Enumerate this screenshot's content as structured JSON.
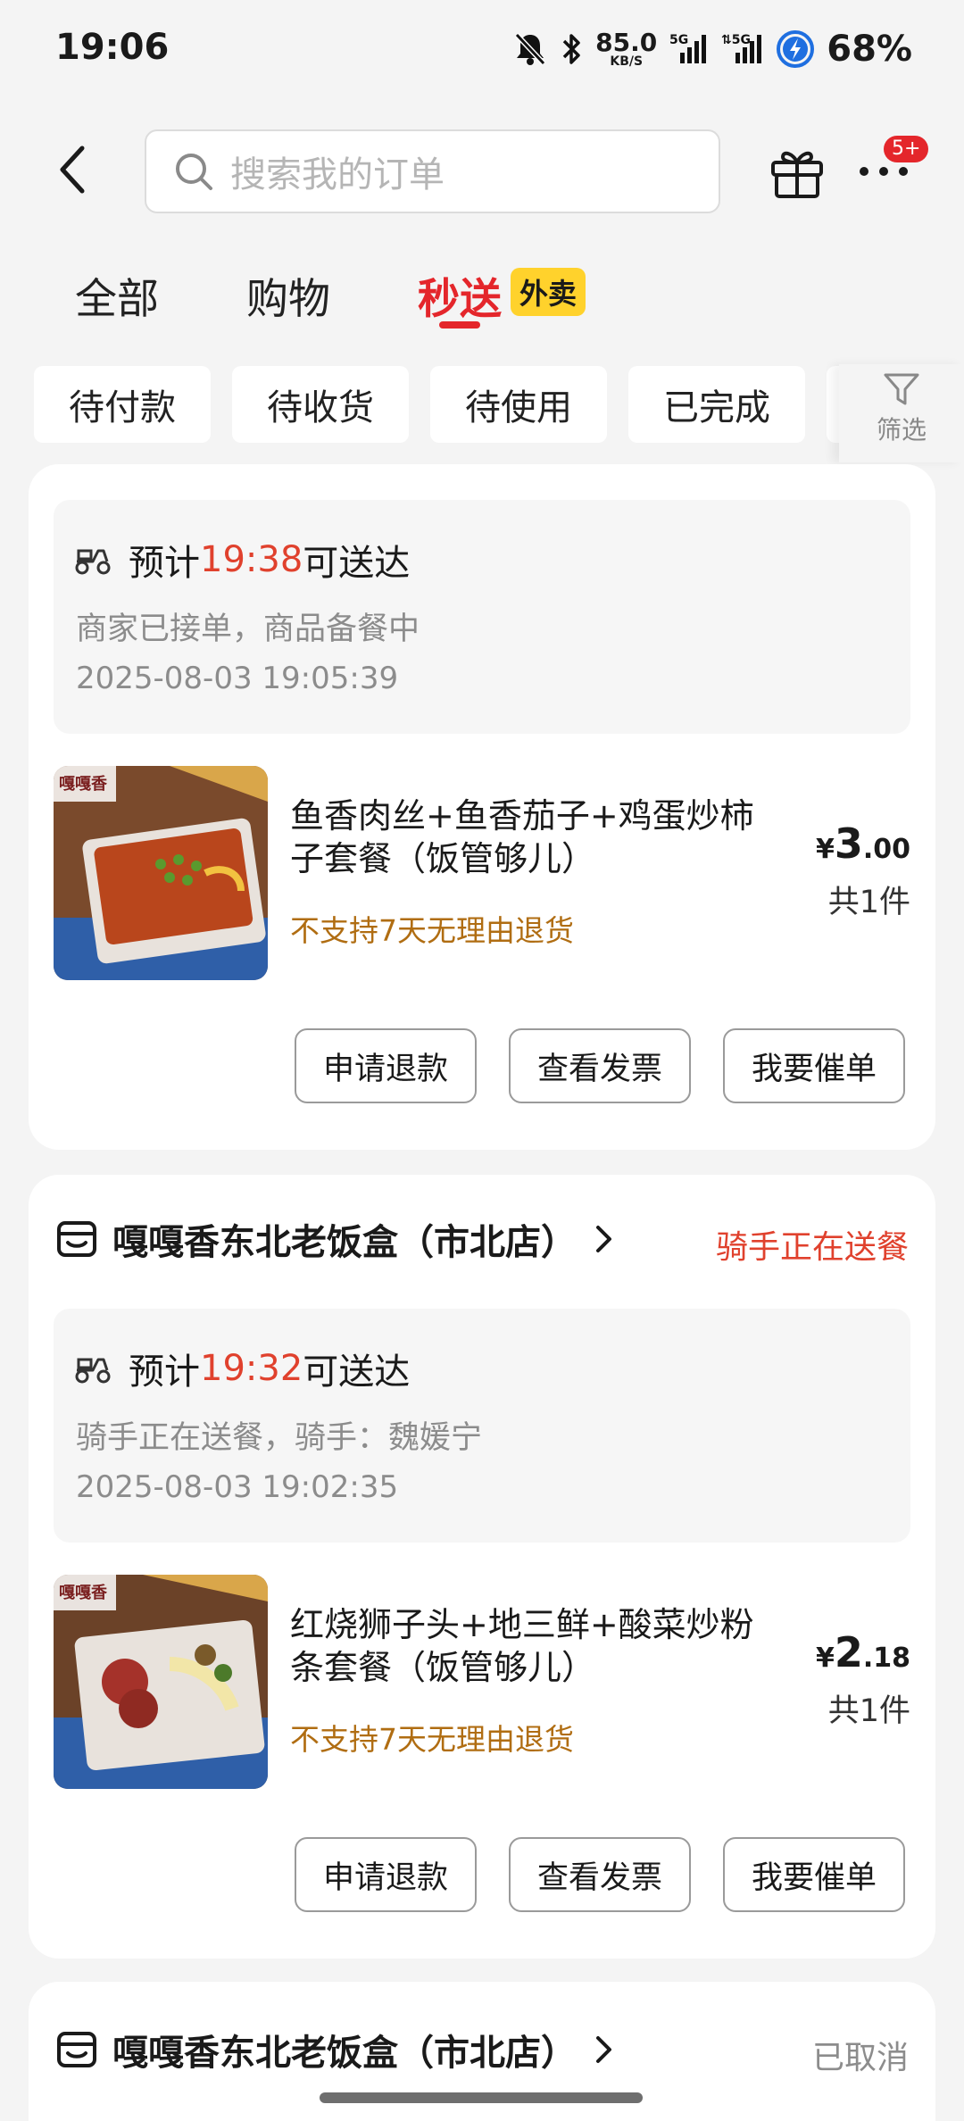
{
  "status": {
    "time": "19:06",
    "net_speed": "85.0",
    "net_unit": "KB/S",
    "sig1": "5G",
    "sig2": "5G",
    "battery": "68%"
  },
  "header": {
    "search_placeholder": "搜索我的订单",
    "badge": "5+"
  },
  "tabs": [
    {
      "label": "全部"
    },
    {
      "label": "购物"
    },
    {
      "label": "秒送"
    }
  ],
  "tab_tag": "外卖",
  "chips": [
    {
      "label": "待付款"
    },
    {
      "label": "待收货"
    },
    {
      "label": "待使用"
    },
    {
      "label": "已完成"
    }
  ],
  "filter_label": "筛选",
  "orders": [
    {
      "eta_prefix": "预计",
      "eta_time": "19:38",
      "eta_suffix": "可送达",
      "sub": "商家已接单，商品备餐中",
      "date": "2025-08-03 19:05:39",
      "img_text": "嘎嘎香",
      "title": "鱼香肉丝+鱼香茄子+鸡蛋炒柿子套餐（饭管够儿）",
      "note": "不支持7天无理由退货",
      "currency": "¥",
      "price_int": "3",
      "price_dec": ".00",
      "count": "共1件",
      "buttons": [
        "申请退款",
        "查看发票",
        "我要催单"
      ]
    },
    {
      "shop": "嘎嘎香东北老饭盒（市北店）",
      "status": "骑手正在送餐",
      "eta_prefix": "预计",
      "eta_time": "19:32",
      "eta_suffix": "可送达",
      "sub": "骑手正在送餐，骑手：魏媛宁",
      "date": "2025-08-03 19:02:35",
      "img_text": "嘎嘎香",
      "title": "红烧狮子头+地三鲜+酸菜炒粉条套餐（饭管够儿）",
      "note": "不支持7天无理由退货",
      "currency": "¥",
      "price_int": "2",
      "price_dec": ".18",
      "count": "共1件",
      "buttons": [
        "申请退款",
        "查看发票",
        "我要催单"
      ]
    },
    {
      "shop": "嘎嘎香东北老饭盒（市北店）",
      "status": "已取消"
    }
  ]
}
